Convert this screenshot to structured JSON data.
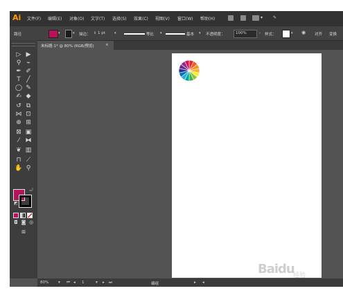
{
  "app": {
    "logo": "Ai"
  },
  "menubar": {
    "items": [
      "文件(F)",
      "编辑(E)",
      "对象(O)",
      "文字(T)",
      "选择(S)",
      "效果(C)",
      "视图(V)",
      "窗口(W)",
      "帮助(H)"
    ]
  },
  "options": {
    "path_label": "路径",
    "fill_color": "#b5145a",
    "stroke_label": "描边：",
    "stroke_value": "1 pt",
    "profile_label": "等比",
    "brush_label": "基本",
    "opacity_label": "不透明度：",
    "opacity_value": "100%",
    "style_label": "样式：",
    "align_label": "对齐",
    "transform_label": "变换"
  },
  "document": {
    "tab_title": "未标题-1* @ 80% (RGB/预览)",
    "close_glyph": "×"
  },
  "toolbox": {
    "fill_color": "#b5145a",
    "stroke_color": "#000000"
  },
  "status": {
    "zoom": "80%",
    "page": "1",
    "mode": "编组"
  },
  "artwork": {
    "wheel_colors": [
      "#e8232a",
      "#f15a24",
      "#f7931e",
      "#fbb03b",
      "#fcee21",
      "#8cc63f",
      "#39b54a",
      "#00a99d",
      "#29abe2",
      "#0071bc",
      "#2e3192",
      "#662d91",
      "#93278f",
      "#d4145a"
    ]
  },
  "watermark": {
    "brand": "Baidu",
    "suffix": "经验"
  }
}
